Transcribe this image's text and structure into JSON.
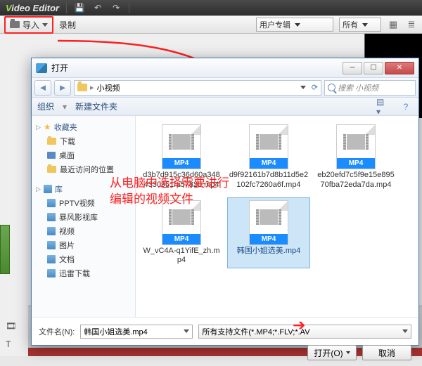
{
  "app": {
    "title_v": "V",
    "title_rest": "ideo  Editor"
  },
  "toolbar": {
    "import_label": "导入",
    "record_label": "录制",
    "combo1": "用户专辑",
    "combo2": "所有"
  },
  "dialog": {
    "title": "打开",
    "breadcrumb_root": "",
    "breadcrumb_folder": "小视频",
    "search_placeholder": "搜索 小视频",
    "organize": "组织",
    "new_folder": "新建文件夹",
    "sidebar": {
      "fav_header": "收藏夹",
      "fav_items": [
        "下载",
        "桌面",
        "最近访问的位置"
      ],
      "lib_header": "库",
      "lib_items": [
        "PPTV视频",
        "暴风影视库",
        "视频",
        "图片",
        "文档",
        "迅雷下载"
      ]
    },
    "files": [
      {
        "badge": "MP4",
        "name": "d3b7d915c36d60a3484330951fa57828.mp4",
        "selected": false
      },
      {
        "badge": "MP4",
        "name": "d9f92161b7d8b11d5e2102fc7260a6f.mp4",
        "selected": false
      },
      {
        "badge": "MP4",
        "name": "eb20efd7c5f9e15e89570fba72eda7da.mp4",
        "selected": false
      },
      {
        "badge": "MP4",
        "name": "W_vC4A-q1YifE_zh.mp4",
        "selected": false
      },
      {
        "badge": "MP4",
        "name": "韩国小姐选美.mp4",
        "selected": true
      }
    ],
    "filename_label": "文件名(N):",
    "filename_value": "韩国小姐选美.mp4",
    "filter_value": "所有支持文件(*.MP4;*.FLV;*.AV",
    "open_btn": "打开(O)",
    "cancel_btn": "取消"
  },
  "annotation": "从电脑中选择需要进行编辑的视频文件"
}
